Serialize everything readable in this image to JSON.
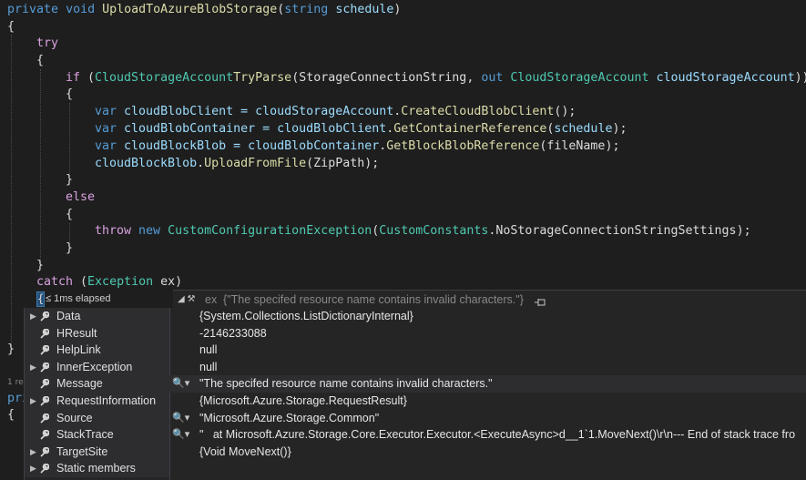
{
  "code": {
    "l1": {
      "kw1": "private",
      "kw2": "void",
      "method": "UploadToAzureBlobStorage",
      "p1": "(",
      "type": "string",
      "param": "schedule",
      "p2": ")"
    },
    "l2": "{",
    "l3": "try",
    "l4": "{",
    "l5": {
      "kw": "if",
      "open": " (",
      "cls1": "CloudStorageAccount",
      ".": ".",
      "m": "TryParse",
      "args1": "(StorageConnectionString, ",
      "out": "out",
      "sp": " ",
      "cls2": "CloudStorageAccount",
      "sp2": " ",
      "var": "cloudStorageAccount",
      "close": "))"
    },
    "l6": "{",
    "l7": {
      "kw": "var",
      "v": " cloudBlobClient = ",
      "obj": "cloudStorageAccount",
      "dot": ".",
      "m": "CreateCloudBlobClient",
      "end": "();"
    },
    "l8": {
      "kw": "var",
      "v": " cloudBlobContainer = ",
      "obj": "cloudBlobClient",
      "dot": ".",
      "m": "GetContainerReference",
      "a": "(",
      "arg": "schedule",
      "end": ");"
    },
    "l9": {
      "kw": "var",
      "v": " cloudBlockBlob = ",
      "obj": "cloudBlobContainer",
      "dot": ".",
      "m": "GetBlockBlobReference",
      "end": "(fileName);"
    },
    "l10": {
      "obj": "cloudBlockBlob",
      "dot": ".",
      "m": "UploadFromFile",
      "end": "(ZipPath);"
    },
    "l11": "}",
    "l12": "else",
    "l13": "{",
    "l14": {
      "kw1": "throw",
      "kw2": "new",
      "cls1": "CustomConfigurationException",
      "p": "(",
      "cls2": "CustomConstants",
      "dot": ".",
      "member": "NoStorageConnectionStringSettings",
      "end": ");"
    },
    "l15": "}",
    "l16": "}",
    "l17": {
      "kw": "catch",
      "open": " (",
      "cls": "Exception",
      "rest": " ex)"
    },
    "l18_brace": "{",
    "l19_brace": "}",
    "frag_ref": "1 re",
    "frag_pri": "pri",
    "frag_brace": "{"
  },
  "perf_tip": "≤ 1ms elapsed",
  "datatip": {
    "header": {
      "name": "ex",
      "value": "{\"The specifed resource name contains invalid characters.\"}"
    },
    "rows": [
      {
        "name": "Data",
        "value": "{System.Collections.ListDictionaryInternal}",
        "expandable": true,
        "viewer": false
      },
      {
        "name": "HResult",
        "value": "-2146233088",
        "expandable": false,
        "viewer": false
      },
      {
        "name": "HelpLink",
        "value": "null",
        "expandable": false,
        "viewer": false
      },
      {
        "name": "InnerException",
        "value": "null",
        "expandable": true,
        "viewer": false
      },
      {
        "name": "Message",
        "value": "\"The specifed resource name contains invalid characters.\"",
        "expandable": false,
        "viewer": true
      },
      {
        "name": "RequestInformation",
        "value": "{Microsoft.Azure.Storage.RequestResult}",
        "expandable": true,
        "viewer": false
      },
      {
        "name": "Source",
        "value": "\"Microsoft.Azure.Storage.Common\"",
        "expandable": false,
        "viewer": true
      },
      {
        "name": "StackTrace",
        "value": "\"   at Microsoft.Azure.Storage.Core.Executor.Executor.<ExecuteAsync>d__1`1.MoveNext()\\r\\n--- End of stack trace fro",
        "expandable": false,
        "viewer": true
      },
      {
        "name": "TargetSite",
        "value": "{Void MoveNext()}",
        "expandable": true,
        "viewer": false
      },
      {
        "name": "Static members",
        "value": "",
        "expandable": true,
        "viewer": false
      }
    ]
  },
  "colors": {
    "keyword": "#569cd6",
    "class": "#4ec9b0",
    "method": "#dcdcaa",
    "variable": "#9cdcfe",
    "control": "#d8a0df"
  }
}
